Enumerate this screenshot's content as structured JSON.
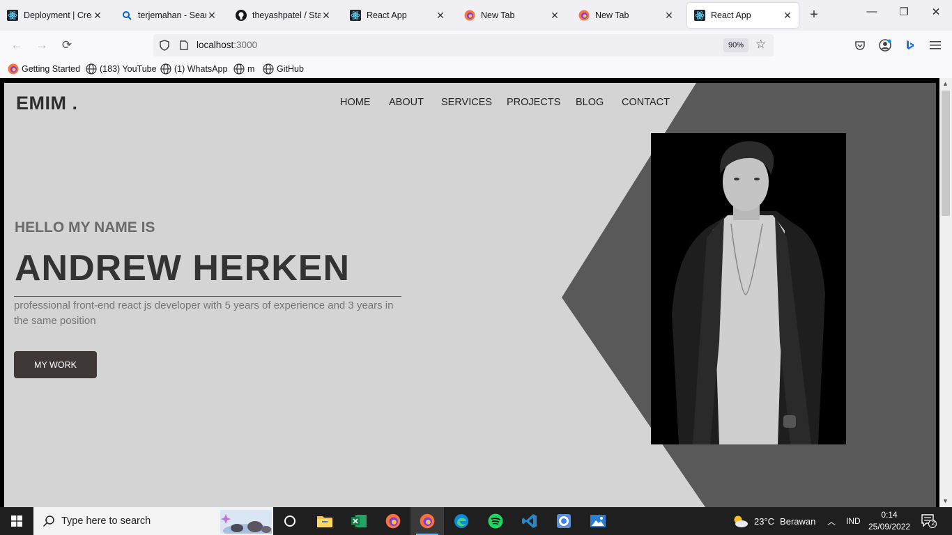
{
  "browser": {
    "tabs": [
      {
        "title": "Deployment | Create",
        "icon": "react-icon"
      },
      {
        "title": "terjemahan - Search",
        "icon": "search-icon"
      },
      {
        "title": "theyashpatel / Starre",
        "icon": "github-icon"
      },
      {
        "title": "React App",
        "icon": "react-icon"
      },
      {
        "title": "New Tab",
        "icon": "firefox-icon"
      },
      {
        "title": "New Tab",
        "icon": "firefox-icon"
      },
      {
        "title": "React App",
        "icon": "react-icon",
        "active": true
      }
    ],
    "url_host": "localhost",
    "url_port": ":3000",
    "zoom": "90%",
    "bookmarks": [
      {
        "label": "Getting Started",
        "icon": "firefox-icon"
      },
      {
        "label": "(183) YouTube",
        "icon": "globe-icon"
      },
      {
        "label": "(1) WhatsApp",
        "icon": "globe-icon"
      },
      {
        "label": "m",
        "icon": "globe-icon"
      },
      {
        "label": "GitHub",
        "icon": "globe-icon"
      }
    ]
  },
  "site": {
    "logo": "EMIM .",
    "nav": [
      "HOME",
      "ABOUT",
      "SERVICES",
      "PROJECTS",
      "BLOG",
      "CONTACT"
    ],
    "greeting": "HELLO MY NAME IS",
    "name": "ANDREW HERKEN",
    "description": "professional front-end react js developer with 5 years of experience and 3 years in the same position",
    "cta": "MY WORK",
    "colors": {
      "background": "#d4d4d4",
      "panel": "#595959",
      "button": "#3e3837"
    }
  },
  "taskbar": {
    "search_placeholder": "Type here to search",
    "weather_temp": "23°C",
    "weather_desc": "Berawan",
    "language": "IND",
    "time": "0:14",
    "date": "25/09/2022",
    "notifications": "2"
  }
}
